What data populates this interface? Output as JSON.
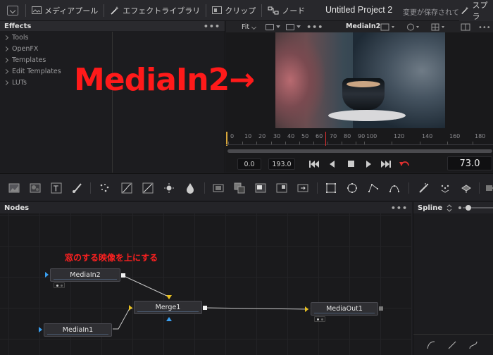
{
  "topbar": {
    "media_pool": "メディアプール",
    "effects_library": "エフェクトライブラリ",
    "clips": "クリップ",
    "nodes": "ノード",
    "project_title": "Untitled Project 2",
    "save_status": "変更が保存されていません",
    "right_button": "スプラ"
  },
  "effects": {
    "title": "Effects",
    "items": [
      "Tools",
      "OpenFX",
      "Templates",
      "Edit Templates",
      "LUTs"
    ]
  },
  "viewer": {
    "fit": "Fit",
    "clip_name": "MediaIn2",
    "overlay_label": "MediaIn2→",
    "ruler_ticks": [
      "0",
      "10",
      "20",
      "30",
      "40",
      "50",
      "60",
      "70",
      "80",
      "90",
      "100",
      "120",
      "140",
      "160",
      "180"
    ],
    "timecode_in": "0.0",
    "timecode_out": "193.0",
    "current_frame": "73.0"
  },
  "nodes_panel": {
    "title": "Nodes",
    "annotation": "窓のする映像を上にする",
    "nodes": {
      "mediain2": "MediaIn2",
      "mediain1": "MediaIn1",
      "merge1": "Merge1",
      "mediaout1": "MediaOut1"
    }
  },
  "spline_panel": {
    "title": "Spline"
  },
  "colors": {
    "accent_red": "#ff1a1a",
    "playhead": "#e03030",
    "port_blue": "#3a9ff0",
    "port_yellow": "#e8c020"
  }
}
